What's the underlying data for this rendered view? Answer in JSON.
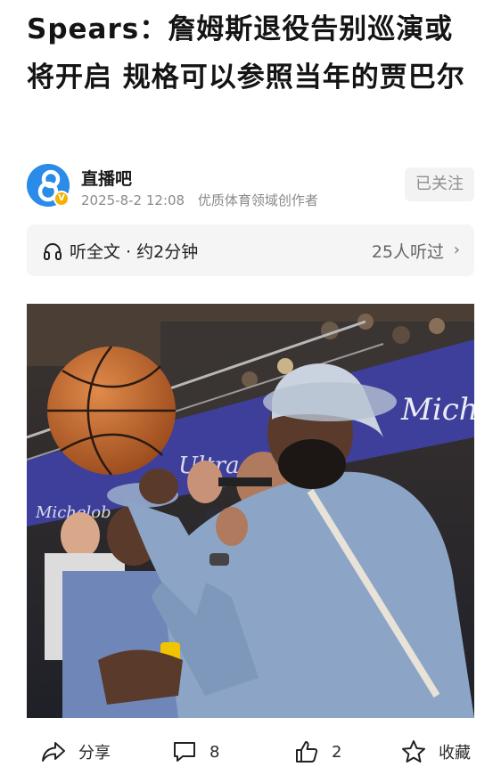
{
  "article": {
    "title": "Spears：詹姆斯退役告别巡演或将开启 规格可以参照当年的贾巴尔"
  },
  "author": {
    "name": "直播吧",
    "date": "2025-8-2 12:08",
    "tag": "优质体育领域创作者",
    "avatar_icon": "zhibo8-logo",
    "follow_label": "已关注"
  },
  "listen": {
    "icon": "headphones-icon",
    "label": "听全文 · 约2分钟",
    "count": "25人听过"
  },
  "photo": {
    "description_icon": "article-photo"
  },
  "actions": {
    "share": "分享",
    "comments": "8",
    "likes": "2",
    "favorite": "收藏"
  },
  "colors": {
    "avatar_blue": "#2b8be8",
    "verified_badge": "#f5b100",
    "muted_text": "#8a8a8a"
  }
}
